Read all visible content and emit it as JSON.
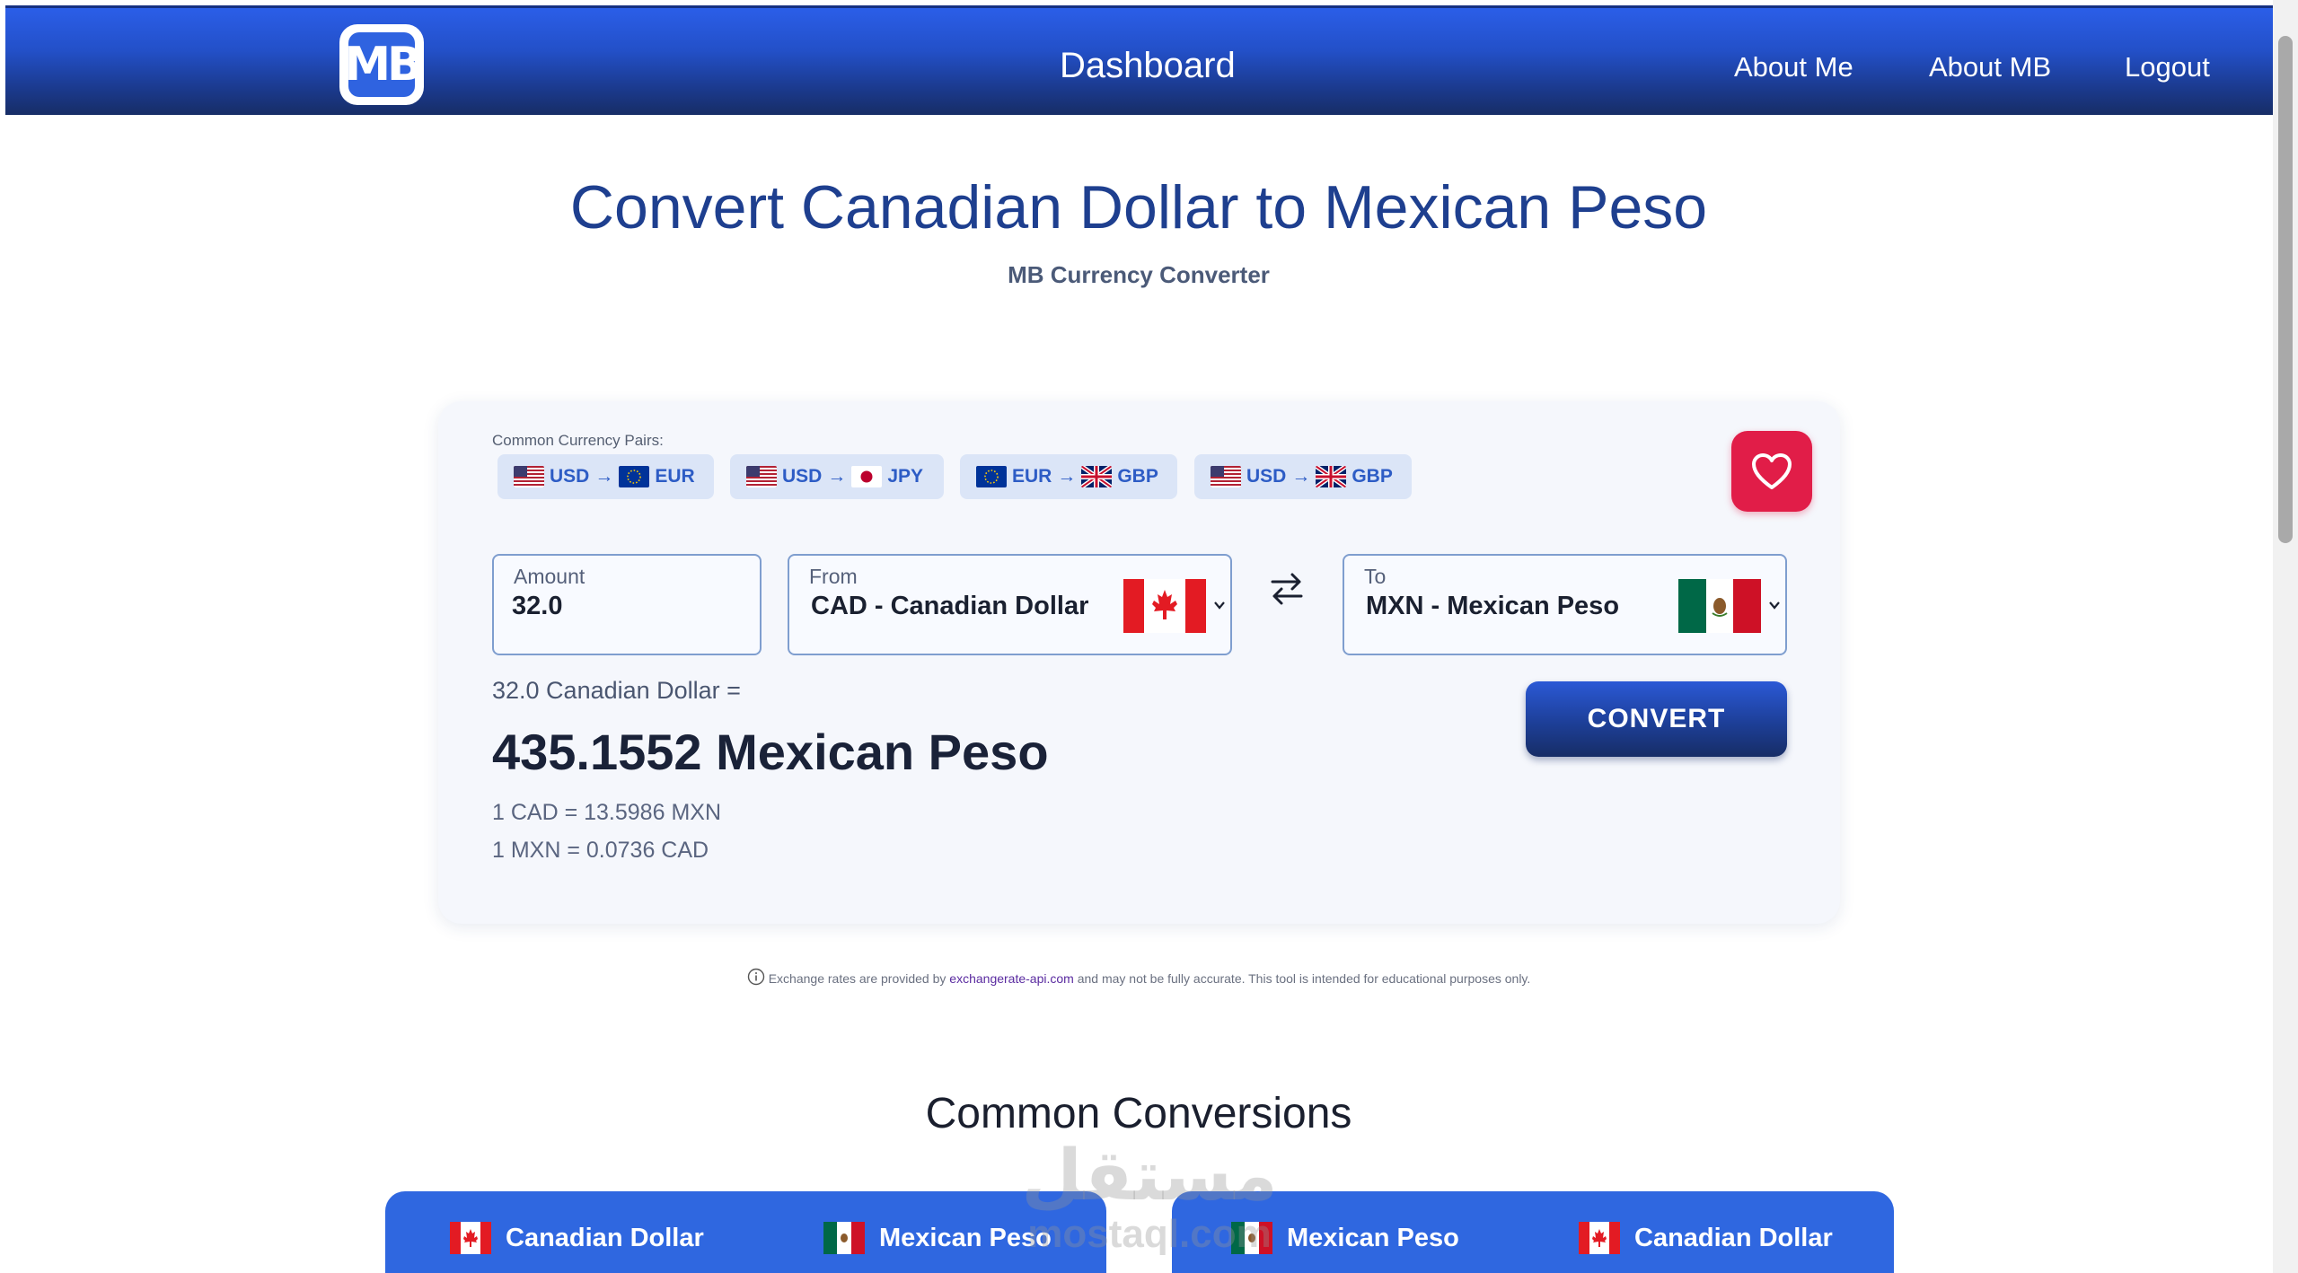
{
  "navbar": {
    "logo_text": "MB",
    "title": "Dashboard",
    "links": [
      "About Me",
      "About MB",
      "Logout"
    ]
  },
  "hero": {
    "title": "Convert Canadian Dollar to Mexican Peso",
    "subtitle": "MB Currency Converter"
  },
  "pairs": {
    "label": "Common Currency Pairs:",
    "items": [
      {
        "from": "USD",
        "arrow": "→",
        "to": "EUR",
        "from_flag": "us-flag-icon",
        "to_flag": "eu-flag-icon"
      },
      {
        "from": "USD",
        "arrow": "→",
        "to": "JPY",
        "from_flag": "us-flag-icon",
        "to_flag": "jp-flag-icon"
      },
      {
        "from": "EUR",
        "arrow": "→",
        "to": "GBP",
        "from_flag": "eu-flag-icon",
        "to_flag": "uk-flag-icon"
      },
      {
        "from": "USD",
        "arrow": "→",
        "to": "GBP",
        "from_flag": "us-flag-icon",
        "to_flag": "uk-flag-icon"
      }
    ]
  },
  "form": {
    "amount_label": "Amount",
    "amount_value": "32.0",
    "from_label": "From",
    "from_value": "CAD - Canadian Dollar",
    "to_label": "To",
    "to_value": "MXN - Mexican Peso",
    "convert_label": "CONVERT"
  },
  "result": {
    "line": "32.0 Canadian Dollar =",
    "value": "435.1552 Mexican Peso",
    "rate_forward": "1 CAD = 13.5986 MXN",
    "rate_reverse": "1 MXN = 0.0736 CAD"
  },
  "disclaimer": {
    "before": "Exchange rates are provided by ",
    "link": "exchangerate-api.com",
    "after": " and may not be fully accurate. This tool is intended for educational purposes only."
  },
  "common": {
    "title": "Common Conversions",
    "cards": [
      {
        "from": "Canadian Dollar",
        "to": "Mexican Peso"
      },
      {
        "from": "Mexican Peso",
        "to": "Canadian Dollar"
      }
    ]
  },
  "watermark": {
    "arabic": "مستقل",
    "latin": "mostaql.com"
  },
  "colors": {
    "accent": "#2f67e0",
    "title": "#1e3f8f",
    "favorite": "#e11d48"
  }
}
